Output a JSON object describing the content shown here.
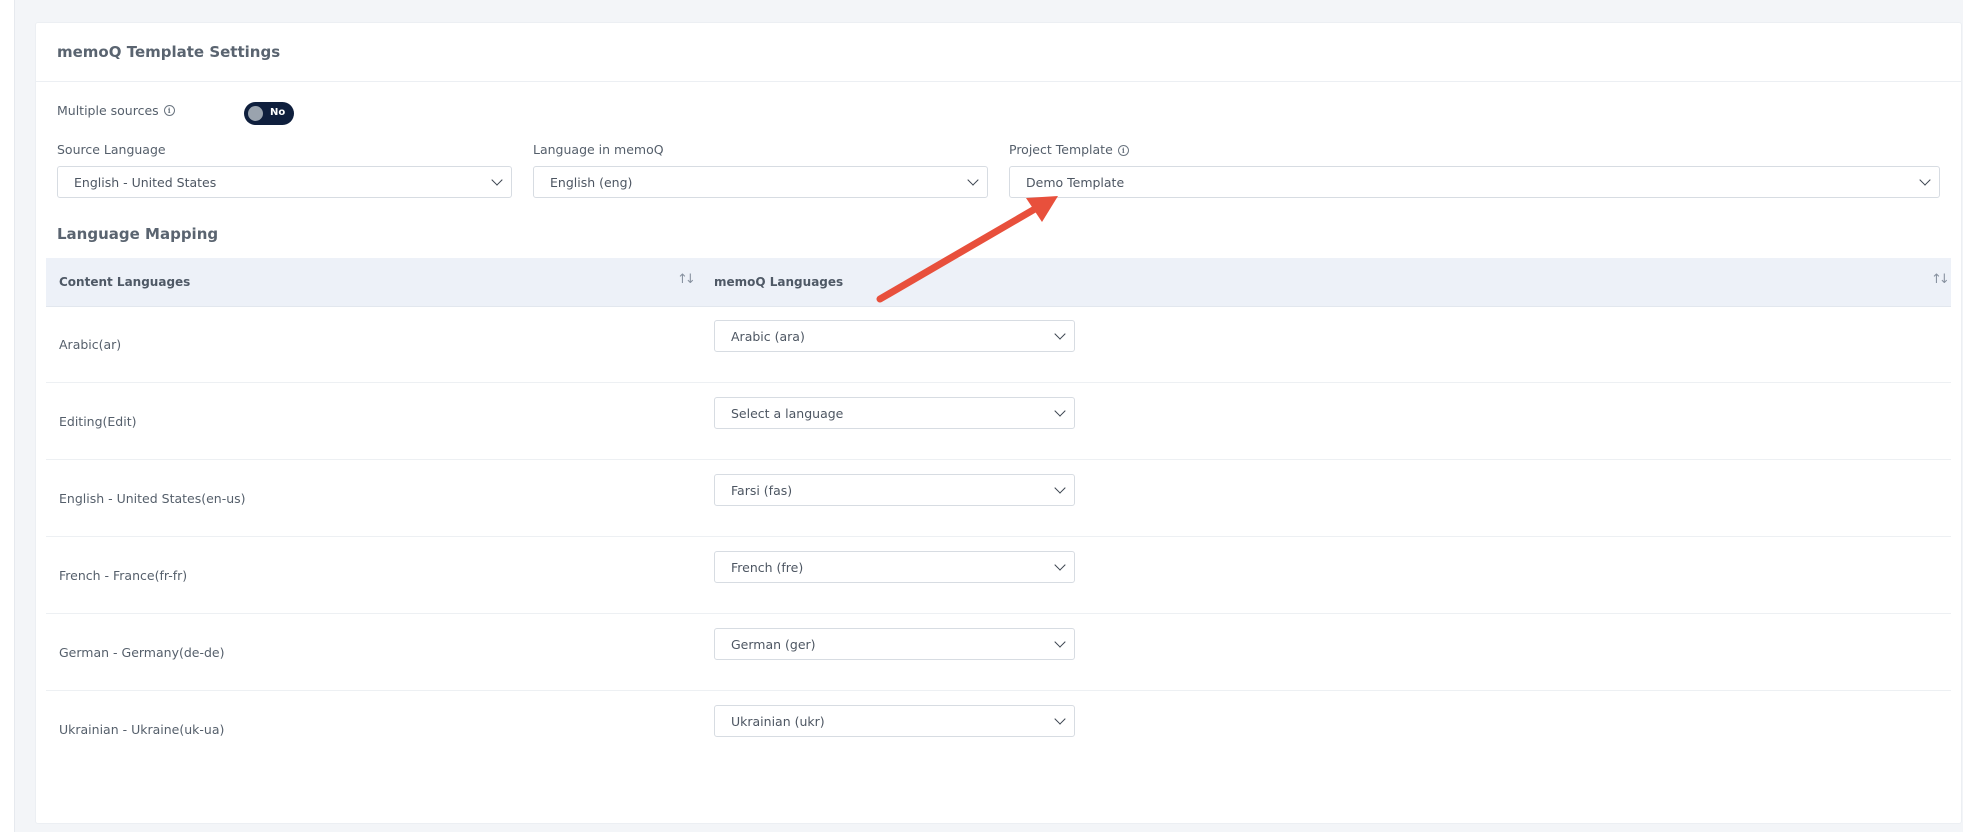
{
  "card": {
    "title": "memoQ Template Settings"
  },
  "multiple_sources": {
    "label": "Multiple sources",
    "toggle_text": "No"
  },
  "fields": {
    "source_language": {
      "label": "Source Language",
      "value": "English - United States"
    },
    "language_in_memoq": {
      "label": "Language in memoQ",
      "value": "English (eng)"
    },
    "project_template": {
      "label": "Project Template",
      "value": "Demo Template"
    }
  },
  "mapping": {
    "title": "Language Mapping",
    "columns": [
      "Content Languages",
      "memoQ Languages"
    ],
    "rows": [
      {
        "content": "Arabic(ar)",
        "memoq": "Arabic (ara)"
      },
      {
        "content": "Editing(Edit)",
        "memoq": "Select a language"
      },
      {
        "content": "English - United States(en-us)",
        "memoq": "Farsi (fas)"
      },
      {
        "content": "French - France(fr-fr)",
        "memoq": "French (fre)"
      },
      {
        "content": "German - Germany(de-de)",
        "memoq": "German (ger)"
      },
      {
        "content": "Ukrainian - Ukraine(uk-ua)",
        "memoq": "Ukrainian (ukr)"
      }
    ]
  },
  "colors": {
    "toggle_bg": "#0f1f3d",
    "arrow": "#e8503c",
    "header_bg": "#edf1f8"
  }
}
